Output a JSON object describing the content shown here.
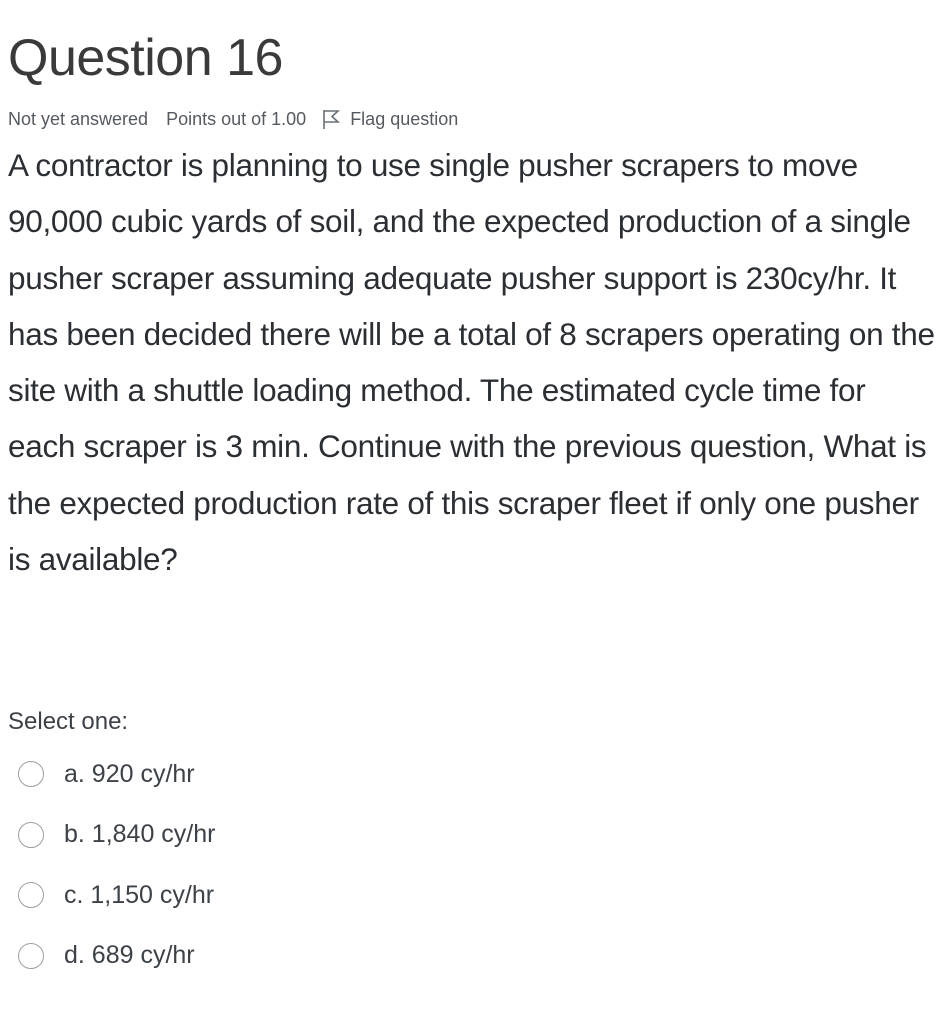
{
  "question": {
    "title": "Question 16",
    "status": "Not yet answered",
    "points": "Points out of 1.00",
    "flag_label": "Flag question",
    "flag_icon": "flag-outline-icon",
    "text": "A contractor is planning to use single pusher scrapers to move 90,000 cubic yards of soil, and the expected production of a single pusher scraper assuming adequate pusher support is 230cy/hr. It has been decided there will be a total of 8 scrapers operating on the site with a shuttle loading method. The estimated cycle time for each scraper is 3 min. Continue with the previous question, What is the expected production rate of this scraper fleet if only one pusher is available?"
  },
  "answer": {
    "prompt": "Select one:",
    "options": [
      {
        "label": "a. 920 cy/hr",
        "selected": false
      },
      {
        "label": "b. 1,840 cy/hr",
        "selected": false
      },
      {
        "label": "c. 1,150 cy/hr",
        "selected": false
      },
      {
        "label": "d. 689 cy/hr",
        "selected": false
      }
    ]
  }
}
